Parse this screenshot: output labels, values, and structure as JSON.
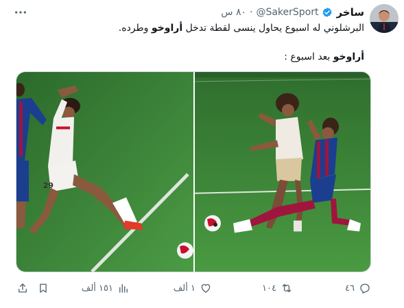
{
  "tweet": {
    "author": {
      "display_name": "ساخر",
      "handle": "@SakerSport",
      "dot": "·",
      "time": "٨٠ س",
      "avatar_icon": "avatar-photo"
    },
    "line1_before": "البرشلوني له اسبوع يحاول ينسى لقطة تدخل ",
    "line1_bold": "أراوخو",
    "line1_after": " وطرده.",
    "line2_bold": "أراوخو",
    "line2_after": " بعد اسبوع :",
    "more_icon": "more-horizontal-icon"
  },
  "media": {
    "left_player_number": "29",
    "left_description_icon": "football-photo",
    "right_description_icon": "football-photo"
  },
  "actions": {
    "replies": "٤٦",
    "retweets": "١٠٤",
    "likes": "١ ألف",
    "views": "١٥١ ألف",
    "icons": [
      "reply-icon",
      "retweet-icon",
      "like-icon",
      "views-icon",
      "bookmark-icon",
      "share-icon"
    ]
  },
  "colors": {
    "text": "#0f1419",
    "secondary": "#536471",
    "verified": "#1d9bf0",
    "pitch": "#3d8a3a"
  }
}
